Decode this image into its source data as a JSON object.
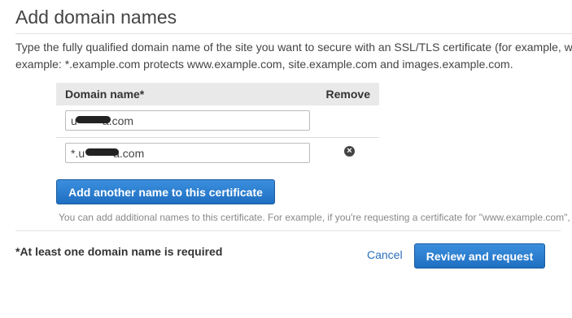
{
  "header": {
    "title": "Add domain names"
  },
  "intro": {
    "line1": "Type the fully qualified domain name of the site you want to secure with an SSL/TLS certificate (for example, w",
    "line2": "example: *.example.com protects www.example.com, site.example.com and images.example.com."
  },
  "table": {
    "col_domain": "Domain name*",
    "col_remove": "Remove",
    "rows": [
      {
        "value": "u        a.com",
        "removable": false
      },
      {
        "value": "*.u         a.com",
        "removable": true,
        "remove_icon": "close-circle-icon"
      }
    ]
  },
  "add_button_label": "Add another name to this certificate",
  "hint": "You can add additional names to this certificate. For example, if you're requesting a certificate for \"www.example.com\",",
  "footer": {
    "required_note": "*At least one domain name is required",
    "cancel_label": "Cancel",
    "review_label": "Review and request"
  },
  "colors": {
    "primary_button": "#2575c7",
    "link": "#2a6fbd",
    "table_header_bg": "#e9e9e9"
  }
}
